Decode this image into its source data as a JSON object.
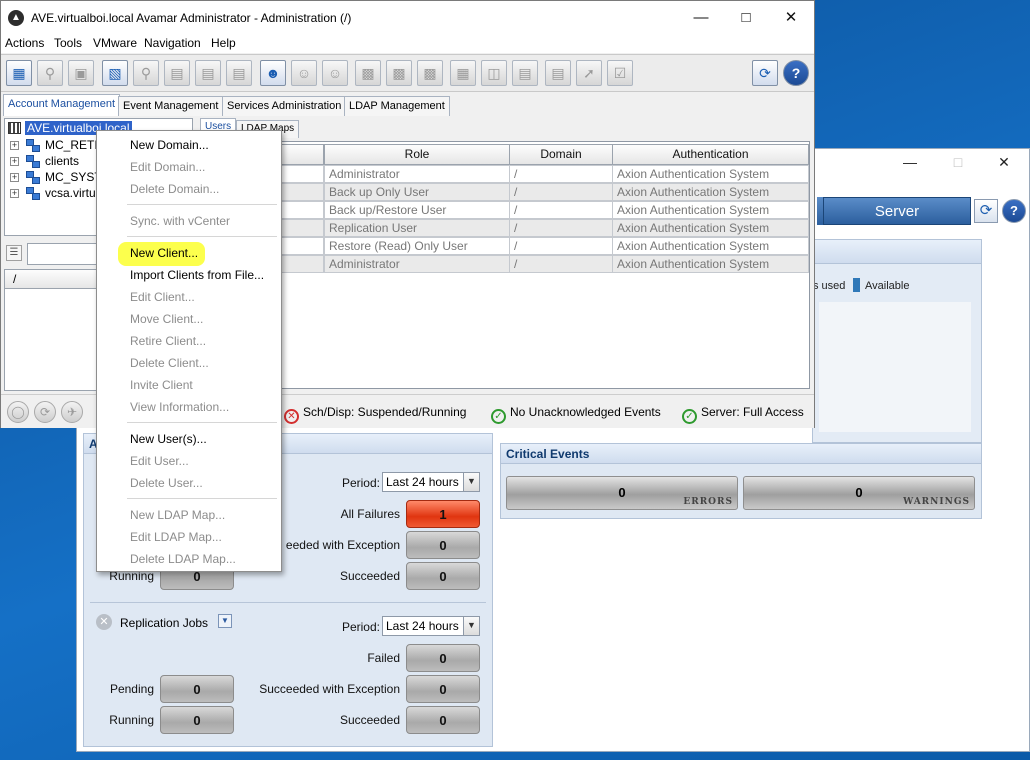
{
  "dashboard": {
    "server_button": "Server",
    "legend": {
      "used_label": "s used",
      "available_label": "Available",
      "available_color": "#2f78b8"
    },
    "activities_panel": {
      "title_fragment": "A",
      "period_label": "Period:",
      "period_value": "Last 24 hours",
      "all_failures_label": "All Failures",
      "all_failures_value": "1",
      "succeeded_exception_label": "eeded with Exception",
      "succeeded_exception_value": "0",
      "succeeded_label": "Succeeded",
      "succeeded_value": "0",
      "running_label": "Running",
      "running_value": "0"
    },
    "replication_panel": {
      "title": "Replication Jobs",
      "period_label": "Period:",
      "period_value": "Last 24 hours",
      "failed_label": "Failed",
      "failed_value": "0",
      "pending_label": "Pending",
      "pending_value": "0",
      "succeeded_exception_label": "Succeeded with Exception",
      "succeeded_exception_value": "0",
      "running_label": "Running",
      "running_value": "0",
      "succeeded_label": "Succeeded",
      "succeeded_value": "0"
    },
    "critical_events": {
      "title": "Critical Events",
      "errors_value": "0",
      "errors_label": "ERRORS",
      "warnings_value": "0",
      "warnings_label": "WARNINGS"
    }
  },
  "main_window": {
    "title": "AVE.virtualboi.local Avamar Administrator - Administration (/)",
    "menu": [
      "Actions",
      "Tools",
      "VMware",
      "Navigation",
      "Help"
    ],
    "tabs": [
      "Account Management",
      "Event Management",
      "Services Administration",
      "LDAP Management"
    ],
    "tree": {
      "root": "AVE.virtualboi.local",
      "children": [
        "MC_RETI",
        "clients",
        "MC_SYST",
        "vcsa.virtu"
      ]
    },
    "lower_left_header": "/",
    "subtabs": [
      "Users",
      "LDAP Maps"
    ],
    "grid": {
      "columns": [
        "Role",
        "Domain",
        "Authentication"
      ],
      "rows": [
        {
          "role": "Administrator",
          "domain": "/",
          "auth": "Axion Authentication System"
        },
        {
          "role": "Back up Only User",
          "domain": "/",
          "auth": "Axion Authentication System"
        },
        {
          "role": "Back up/Restore User",
          "domain": "/",
          "auth": "Axion Authentication System"
        },
        {
          "role": "Replication User",
          "domain": "/",
          "auth": "Axion Authentication System"
        },
        {
          "role": "Restore (Read) Only User",
          "domain": "/",
          "auth": "Axion Authentication System"
        },
        {
          "role": "Administrator",
          "domain": "/",
          "auth": "Axion Authentication System"
        }
      ]
    },
    "status": {
      "sched": "Sch/Disp: Suspended/Running",
      "events": "No Unacknowledged Events",
      "server": "Server: Full Access"
    }
  },
  "context_menu": {
    "new_domain": "New Domain...",
    "edit_domain": "Edit Domain...",
    "delete_domain": "Delete Domain...",
    "sync_vcenter": "Sync. with vCenter",
    "new_client": "New Client...",
    "import_clients": "Import Clients from File...",
    "edit_client": "Edit Client...",
    "move_client": "Move Client...",
    "retire_client": "Retire Client...",
    "delete_client": "Delete Client...",
    "invite_client": "Invite Client",
    "view_information": "View Information...",
    "new_user": "New User(s)...",
    "edit_user": "Edit User...",
    "delete_user": "Delete User...",
    "new_ldap_map": "New LDAP Map...",
    "edit_ldap_map": "Edit LDAP Map...",
    "delete_ldap_map": "Delete LDAP Map...",
    "highlight_color": "#fbff2e"
  }
}
